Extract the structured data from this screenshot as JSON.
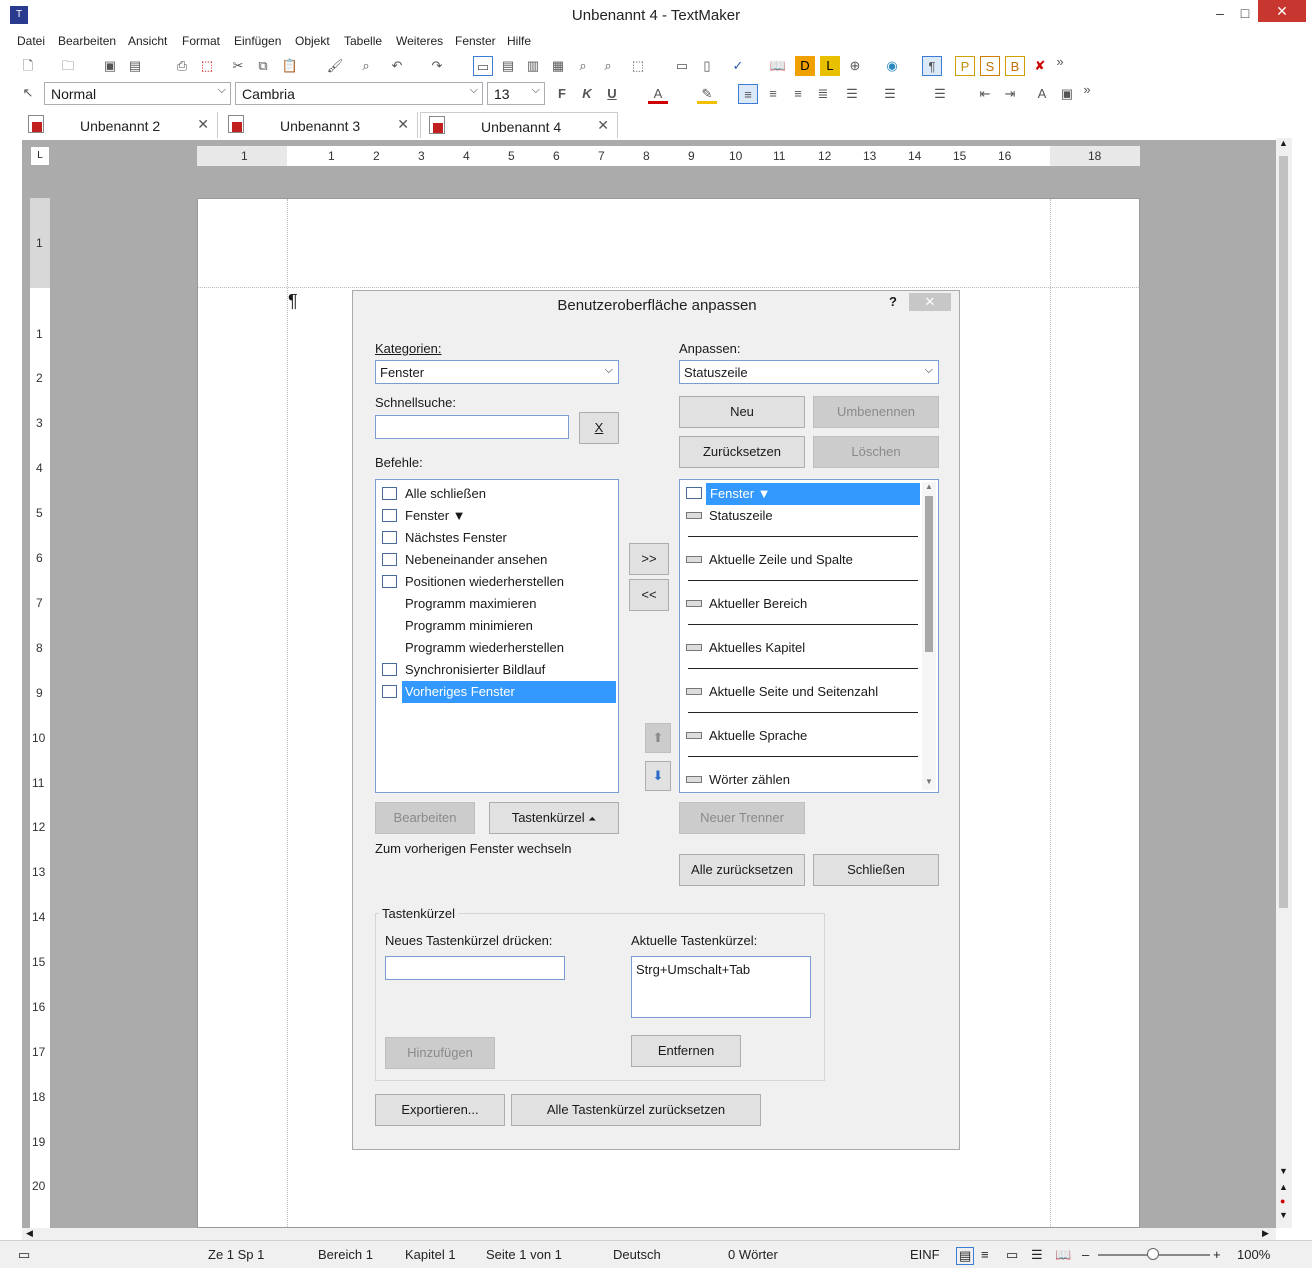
{
  "app": {
    "title": "Unbenannt 4 - TextMaker"
  },
  "menu": [
    "Datei",
    "Bearbeiten",
    "Ansicht",
    "Format",
    "Einfügen",
    "Objekt",
    "Tabelle",
    "Weiteres",
    "Fenster",
    "Hilfe"
  ],
  "format_bar": {
    "style": "Normal",
    "font": "Cambria",
    "size": "13",
    "bold": "F",
    "italic": "K",
    "underline": "U",
    "font_color_letter": "A"
  },
  "tabs": [
    {
      "label": "Unbenannt 2"
    },
    {
      "label": "Unbenannt 3"
    },
    {
      "label": "Unbenannt 4"
    }
  ],
  "ruler": {
    "h": [
      "1",
      "1",
      "2",
      "3",
      "4",
      "5",
      "6",
      "7",
      "8",
      "9",
      "10",
      "11",
      "12",
      "13",
      "14",
      "15",
      "16",
      "18"
    ],
    "v": [
      "1",
      "1",
      "2",
      "3",
      "4",
      "5",
      "6",
      "7",
      "8",
      "9",
      "10",
      "11",
      "12",
      "13",
      "14",
      "15",
      "16",
      "17",
      "18",
      "19",
      "20"
    ]
  },
  "document": {
    "pilcrow": "¶"
  },
  "dialog": {
    "title": "Benutzeroberfläche anpassen",
    "help": "?",
    "close": "✕",
    "kategorien_label": "Kategorien:",
    "kategorien_value": "Fenster",
    "anpassen_label": "Anpassen:",
    "anpassen_value": "Statuszeile",
    "schnellsuche_label": "Schnellsuche:",
    "schnellsuche_value": "",
    "clear_btn": "X",
    "neu_btn": "Neu",
    "umbenennen_btn": "Umbenennen",
    "zuruecksetzen_btn": "Zurücksetzen",
    "loeschen_btn": "Löschen",
    "befehle_label": "Befehle:",
    "befehle": [
      "Alle schließen",
      "Fenster ▼",
      "Nächstes Fenster",
      "Nebeneinander ansehen",
      "Positionen wiederherstellen",
      "Programm maximieren",
      "Programm minimieren",
      "Programm wiederherstellen",
      "Synchronisierter Bildlauf",
      "Vorheriges Fenster"
    ],
    "selected_befehl": "Vorheriges Fenster",
    "add_btn": ">>",
    "remove_btn": "<<",
    "anpassen_items": [
      "Fenster ▼",
      "Statuszeile",
      "Aktuelle Zeile und Spalte",
      "Aktueller Bereich",
      "Aktuelles Kapitel",
      "Aktuelle Seite und Seitenzahl",
      "Aktuelle Sprache",
      "Wörter zählen"
    ],
    "bearbeiten_btn": "Bearbeiten",
    "tastenkuerzel_btn": "Tastenkürzel",
    "neuer_trenner_btn": "Neuer Trenner",
    "description": "Zum vorherigen Fenster wechseln",
    "alle_zuruecksetzen_btn": "Alle zurücksetzen",
    "schliessen_btn": "Schließen",
    "group_title": "Tastenkürzel",
    "neues_label": "Neues Tastenkürzel drücken:",
    "neues_value": "",
    "aktuelle_label": "Aktuelle Tastenkürzel:",
    "aktuelle_value": "Strg+Umschalt+Tab",
    "hinzufuegen_btn": "Hinzufügen",
    "entfernen_btn": "Entfernen",
    "exportieren_btn": "Exportieren...",
    "alle_tk_btn": "Alle Tastenkürzel zurücksetzen"
  },
  "status": {
    "pos": "Ze 1 Sp 1",
    "bereich": "Bereich 1",
    "kapitel": "Kapitel 1",
    "seite": "Seite 1 von 1",
    "sprache": "Deutsch",
    "woerter": "0 Wörter",
    "mode": "EINF",
    "zoom": "100%"
  }
}
